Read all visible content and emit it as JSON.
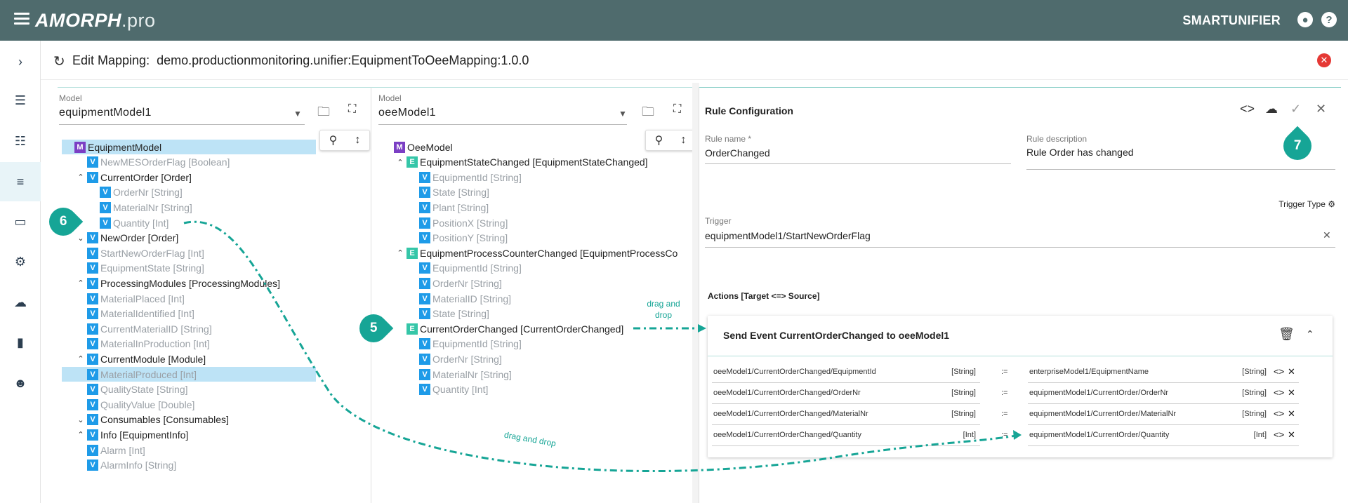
{
  "topbar": {
    "logo_main": "AMORPH",
    "logo_suffix": ".pro",
    "product": "SMARTUNIFIER",
    "user_icon": "user-circle-icon",
    "help_icon": "help-circle-icon",
    "bg_color": "#4f6b6d"
  },
  "nav": {
    "items": [
      "chevron-right-icon",
      "list-icon",
      "sliders-icon",
      "tune-icon",
      "devices-icon",
      "settings-box-icon",
      "cloud-upload-icon",
      "plug-icon",
      "users-icon"
    ],
    "active_index": 3
  },
  "header": {
    "label": "Edit Mapping:",
    "mapping_id": "demo.productionmonitoring.unifier:EquipmentToOeeMapping:1.0.0"
  },
  "left_panel": {
    "model_label": "Model",
    "model_value": "equipmentModel1",
    "tree": [
      {
        "indent": 0,
        "caret": "",
        "badge": "M",
        "name": "EquipmentModel",
        "type": "",
        "style": "strong",
        "highlight": true
      },
      {
        "indent": 1,
        "caret": "",
        "badge": "V",
        "name": "NewMESOrderFlag",
        "type": "[Boolean]",
        "style": "faded"
      },
      {
        "indent": 1,
        "caret": "^",
        "badge": "V",
        "name": "CurrentOrder",
        "type": "[Order]",
        "style": "strong"
      },
      {
        "indent": 2,
        "caret": "",
        "badge": "V",
        "name": "OrderNr",
        "type": "[String]",
        "style": "faded"
      },
      {
        "indent": 2,
        "caret": "",
        "badge": "V",
        "name": "MaterialNr",
        "type": "[String]",
        "style": "faded"
      },
      {
        "indent": 2,
        "caret": "",
        "badge": "V",
        "name": "Quantity",
        "type": "[Int]",
        "style": "faded"
      },
      {
        "indent": 1,
        "caret": "v",
        "badge": "V",
        "name": "NewOrder",
        "type": "[Order]",
        "style": "strong"
      },
      {
        "indent": 1,
        "caret": "",
        "badge": "V",
        "name": "StartNewOrderFlag",
        "type": "[Int]",
        "style": "faded"
      },
      {
        "indent": 1,
        "caret": "",
        "badge": "V",
        "name": "EquipmentState",
        "type": "[String]",
        "style": "faded"
      },
      {
        "indent": 1,
        "caret": "^",
        "badge": "V",
        "name": "ProcessingModules",
        "type": "[ProcessingModules]",
        "style": "strong"
      },
      {
        "indent": 1,
        "caret": "",
        "badge": "V",
        "name": "MaterialPlaced",
        "type": "[Int]",
        "style": "faded"
      },
      {
        "indent": 1,
        "caret": "",
        "badge": "V",
        "name": "MaterialIdentified",
        "type": "[Int]",
        "style": "faded"
      },
      {
        "indent": 1,
        "caret": "",
        "badge": "V",
        "name": "CurrentMaterialID",
        "type": "[String]",
        "style": "faded"
      },
      {
        "indent": 1,
        "caret": "",
        "badge": "V",
        "name": "MaterialInProduction",
        "type": "[Int]",
        "style": "faded"
      },
      {
        "indent": 1,
        "caret": "^",
        "badge": "V",
        "name": "CurrentModule",
        "type": "[Module]",
        "style": "strong"
      },
      {
        "indent": 1,
        "caret": "",
        "badge": "V",
        "name": "MaterialProduced",
        "type": "[Int]",
        "style": "faded",
        "highlight": true
      },
      {
        "indent": 1,
        "caret": "",
        "badge": "V",
        "name": "QualityState",
        "type": "[String]",
        "style": "faded"
      },
      {
        "indent": 1,
        "caret": "",
        "badge": "V",
        "name": "QualityValue",
        "type": "[Double]",
        "style": "faded"
      },
      {
        "indent": 1,
        "caret": "v",
        "badge": "V",
        "name": "Consumables",
        "type": "[Consumables]",
        "style": "strong"
      },
      {
        "indent": 1,
        "caret": "^",
        "badge": "V",
        "name": "Info",
        "type": "[EquipmentInfo]",
        "style": "strong"
      },
      {
        "indent": 1,
        "caret": "",
        "badge": "V",
        "name": "Alarm",
        "type": "[Int]",
        "style": "faded"
      },
      {
        "indent": 1,
        "caret": "",
        "badge": "V",
        "name": "AlarmInfo",
        "type": "[String]",
        "style": "faded"
      }
    ]
  },
  "mid_panel": {
    "model_label": "Model",
    "model_value": "oeeModel1",
    "tree": [
      {
        "indent": 0,
        "caret": "",
        "badge": "M",
        "name": "OeeModel",
        "type": "",
        "style": "strong"
      },
      {
        "indent": 1,
        "caret": "^",
        "badge": "E",
        "name": "EquipmentStateChanged",
        "type": "[EquipmentStateChanged]",
        "style": "strong"
      },
      {
        "indent": 2,
        "caret": "",
        "badge": "V",
        "name": "EquipmentId",
        "type": "[String]",
        "style": "faded"
      },
      {
        "indent": 2,
        "caret": "",
        "badge": "V",
        "name": "State",
        "type": "[String]",
        "style": "faded"
      },
      {
        "indent": 2,
        "caret": "",
        "badge": "V",
        "name": "Plant",
        "type": "[String]",
        "style": "faded"
      },
      {
        "indent": 2,
        "caret": "",
        "badge": "V",
        "name": "PositionX",
        "type": "[String]",
        "style": "faded"
      },
      {
        "indent": 2,
        "caret": "",
        "badge": "V",
        "name": "PositionY",
        "type": "[String]",
        "style": "faded"
      },
      {
        "indent": 1,
        "caret": "^",
        "badge": "E",
        "name": "EquipmentProcessCounterChanged",
        "type": "[EquipmentProcessCo",
        "style": "strong"
      },
      {
        "indent": 2,
        "caret": "",
        "badge": "V",
        "name": "EquipmentId",
        "type": "[String]",
        "style": "faded"
      },
      {
        "indent": 2,
        "caret": "",
        "badge": "V",
        "name": "OrderNr",
        "type": "[String]",
        "style": "faded"
      },
      {
        "indent": 2,
        "caret": "",
        "badge": "V",
        "name": "MaterialID",
        "type": "[String]",
        "style": "faded"
      },
      {
        "indent": 2,
        "caret": "",
        "badge": "V",
        "name": "State",
        "type": "[String]",
        "style": "faded"
      },
      {
        "indent": 1,
        "caret": "",
        "badge": "E",
        "name": "CurrentOrderChanged",
        "type": "[CurrentOrderChanged]",
        "style": "strong"
      },
      {
        "indent": 2,
        "caret": "",
        "badge": "V",
        "name": "EquipmentId",
        "type": "[String]",
        "style": "faded"
      },
      {
        "indent": 2,
        "caret": "",
        "badge": "V",
        "name": "OrderNr",
        "type": "[String]",
        "style": "faded"
      },
      {
        "indent": 2,
        "caret": "",
        "badge": "V",
        "name": "MaterialNr",
        "type": "[String]",
        "style": "faded"
      },
      {
        "indent": 2,
        "caret": "",
        "badge": "V",
        "name": "Quantity",
        "type": "[Int]",
        "style": "faded"
      }
    ]
  },
  "rule": {
    "title": "Rule Configuration",
    "name_label": "Rule name *",
    "name_value": "OrderChanged",
    "desc_label": "Rule description",
    "desc_value": "Rule Order has changed",
    "trigger_type": "Trigger Type",
    "trigger_label": "Trigger",
    "trigger_value": "equipmentModel1/StartNewOrderFlag",
    "actions_title": "Actions [Target <=> Source]",
    "card_title": "Send Event CurrentOrderChanged to oeeModel1",
    "mappings": [
      {
        "target": "oeeModel1/CurrentOrderChanged/EquipmentId",
        "target_type": "[String]",
        "op": ":=",
        "source": "enterpriseModel1/EquipmentName",
        "source_type": "[String]"
      },
      {
        "target": "oeeModel1/CurrentOrderChanged/OrderNr",
        "target_type": "[String]",
        "op": ":=",
        "source": "equipmentModel1/CurrentOrder/OrderNr",
        "source_type": "[String]"
      },
      {
        "target": "oeeModel1/CurrentOrderChanged/MaterialNr",
        "target_type": "[String]",
        "op": ":=",
        "source": "equipmentModel1/CurrentOrder/MaterialNr",
        "source_type": "[String]"
      },
      {
        "target": "oeeModel1/CurrentOrderChanged/Quantity",
        "target_type": "[Int]",
        "op": ":=",
        "source": "equipmentModel1/CurrentOrder/Quantity",
        "source_type": "[Int]"
      }
    ]
  },
  "annotations": {
    "callout_5": "5",
    "callout_6": "6",
    "callout_7": "7",
    "drag_drop_1": "drag and drop",
    "drag_drop_2": "drag and drop",
    "accent_color": "#16a596"
  }
}
